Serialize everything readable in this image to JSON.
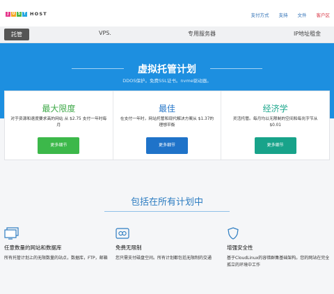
{
  "logo": {
    "letters": [
      "J",
      "U",
      "S",
      "T"
    ],
    "tile_colors": [
      "#e63a8e",
      "#f5a623",
      "#4fb848",
      "#26a7e0"
    ],
    "word": "HOST"
  },
  "top_links": {
    "payment": "支付方式",
    "support": "支持",
    "docs": "文件",
    "account": "客户区"
  },
  "nav": {
    "active": "託管",
    "items": [
      "VPS.",
      "专用服务器",
      "IP地址租金"
    ]
  },
  "hero": {
    "title": "虚拟托管计划",
    "subtitle": "DDOS保护。免费SSL证书。nvme驱动器。",
    "bg_color": "#1d8fe0"
  },
  "plans": [
    {
      "title": "最大限度",
      "title_color": "#3fa949",
      "description": "对于资源和速度要求高的网站 从 $2.75 支付一年时每月",
      "button": "更多细节",
      "button_color": "#3cb84a"
    },
    {
      "title": "最佳",
      "title_color": "#2a78c9",
      "description": "在支付一年时，网站托管和现代解决方案从 $1.37的理想平衡",
      "button": "更多细节",
      "button_color": "#1f73c9"
    },
    {
      "title": "经济学",
      "title_color": "#1fa88e",
      "description": "灵活托管。每月均以无限制的空间和每兆字节从 $0.01",
      "button": "更多细节",
      "button_color": "#18a38a"
    }
  ],
  "features": {
    "title": "包括在所有计划中",
    "items": [
      {
        "icon": "monitor-icon",
        "title": "任意数量的网站和数据库",
        "description": "所有托管计划上的无限数量的站点，数据库，FTP，邮箱"
      },
      {
        "icon": "infinity-icon",
        "title": "免费无限制",
        "description": "您只需支付磁盘空间。所有计划都包括无限制的交通"
      },
      {
        "icon": "shield-icon",
        "title": "增强安全性",
        "description": "基于CloudLinux的容错群集基础架构。您的网站在完全孤立的环境中工作"
      }
    ]
  }
}
